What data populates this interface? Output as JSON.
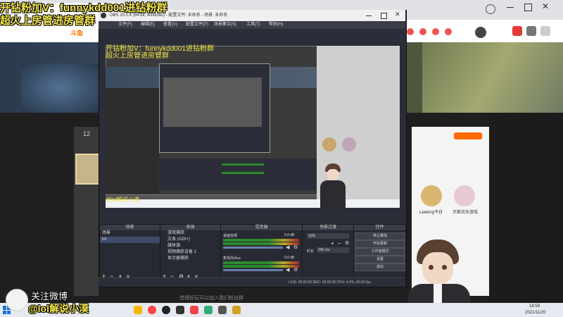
{
  "overlay": {
    "top_line1": "开钻粉加V：funnykdd001进钻粉群",
    "top_line2": "超火上房管进房管群",
    "bottom_line1": "关注微博",
    "bottom_line2": "@lol解说小漠"
  },
  "browser": {
    "tab_title": "",
    "brand_logo_text": "斗鱼",
    "page_count": "12"
  },
  "page": {
    "right_panel_user1": "Leeking今日",
    "right_panel_user2": "贝斯欢乐游戏",
    "bottom_notice": "觉得好玩可以加入我们粉丝群"
  },
  "obs": {
    "title": "OBS 25.0.4 (64-bit, windows) - 配置文件: 未命名 - 场景: 未命名",
    "menu": [
      "文件(F)",
      "编辑(E)",
      "查看(V)",
      "配置文件(P)",
      "场景集合(S)",
      "工具(T)",
      "帮助(H)"
    ],
    "docks": {
      "scenes": {
        "title": "场景",
        "items": [
          "场景",
          "lol"
        ]
      },
      "sources": {
        "title": "来源",
        "items": [
          "游戏捕获",
          "文本 (GDI+)",
          "媒体源",
          "视频捕获设备 2",
          "显示器捕获"
        ]
      },
      "mixer": {
        "title": "混音器",
        "items": [
          "桌面音频",
          "麦克风/Aux"
        ],
        "levels": [
          "0.0 dB",
          "0.0 dB"
        ]
      },
      "transitions": {
        "title": "场景过渡",
        "mode": "淡出",
        "duration_label": "时长",
        "duration": "300 ms"
      },
      "controls": {
        "title": "控件",
        "buttons": [
          "停止推流",
          "开始录制",
          "工作室模式",
          "设置",
          "退出"
        ]
      }
    },
    "status": "LIVE: 00:00:00   REC: 00:00:00   CPU: 4.0%, 60.00 fps"
  },
  "taskbar": {
    "time": "18:59",
    "date": "2021/11/20"
  },
  "colors": {
    "overlay_yellow": "#f2e54a",
    "obs_bg": "#2b2e38",
    "page_dark": "#1f1f1f"
  }
}
